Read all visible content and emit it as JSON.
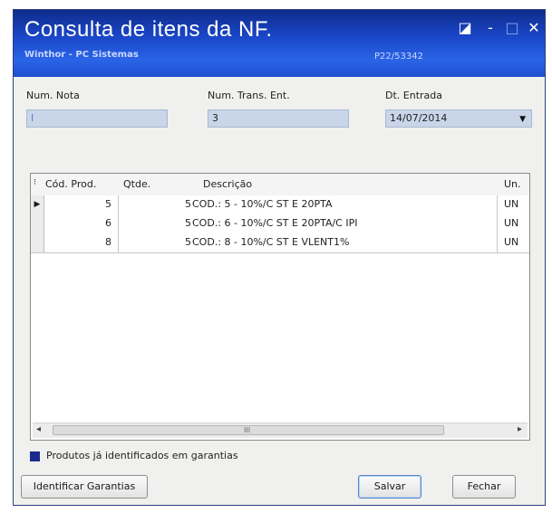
{
  "window": {
    "title": "Consulta de itens da NF.",
    "subtitle": "Winthor - PC Sistemas",
    "code": "P22/53342",
    "restore_glyph": "◪",
    "minimize_glyph": "-",
    "maximize_glyph": "□",
    "close_glyph": "✕"
  },
  "form": {
    "num_nota_label": "Num. Nota",
    "num_nota_value": "I",
    "num_trans_label": "Num. Trans. Ent.",
    "num_trans_value": "3",
    "dt_entrada_label": "Dt. Entrada",
    "dt_entrada_value": "14/07/2014"
  },
  "grid": {
    "columns": [
      "Cód. Prod.",
      "Qtde.",
      "Descrição",
      "Un."
    ],
    "rows": [
      {
        "cod": "5",
        "qtde": "5",
        "descricao": "COD.: 5 - 10%/C ST E 20PTA",
        "un": "UN"
      },
      {
        "cod": "6",
        "qtde": "5",
        "descricao": "COD.: 6 - 10%/C ST E 20PTA/C IPI",
        "un": "UN"
      },
      {
        "cod": "8",
        "qtde": "5",
        "descricao": "COD.: 8 - 10%/C ST E VLENT1%",
        "un": "UN"
      }
    ],
    "current_row_indicator": "▶",
    "scroll_grip": "III"
  },
  "legend": {
    "text": "Produtos já identificados em garantias",
    "color": "#1c2a90"
  },
  "buttons": {
    "identificar": "Identificar Garantias",
    "salvar": "Salvar",
    "fechar": "Fechar"
  },
  "icons": {
    "dropdown": "chevron-down-icon",
    "row_indicator": "row-pointer-icon"
  },
  "colors": {
    "titlebar": "#1a46c8",
    "field_bg": "#c9d6ea"
  }
}
